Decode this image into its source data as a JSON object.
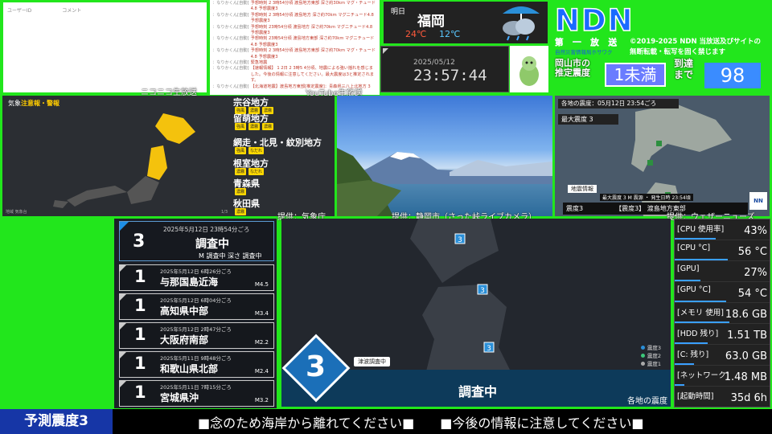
{
  "comments": {
    "col_user": "ユーザーID",
    "col_comment": "コメント",
    "label": "ニコニコ生放送"
  },
  "youtube": {
    "label": "YouTube生放送",
    "rows": [
      {
        "name": "：なりかくん[自動]",
        "text": "予想時刻 2 3時54分頃 渡島地方東部 深さ約30km マグ・チュード4.8 予想震度3"
      },
      {
        "name": "：なりかくん[自動]",
        "text": "予想時刻 2 3時54分頃 渡島地方 深さ約70km マグニチュード4.8 予想震度3"
      },
      {
        "name": "：なりかくん[自動]",
        "text": "予想時刻 23時54分頃 渡島地方 深さ約70km マグニチュード4.8 予想震度3"
      },
      {
        "name": "：なりかくん[自動]",
        "text": "予想時刻 23時54分頃 渡島地方東部 深さ約70km マグニチュード4.8 予想震度3"
      },
      {
        "name": "：なりかくん[自動]",
        "text": "予想時刻 2 3時54分頃 渡島地方東部 深さ約70km マグ・チュード4.8 予想震度3"
      },
      {
        "name": "：なりかくん[自動]",
        "text": "緊急地震"
      },
      {
        "name": "：なりかくん[自動]",
        "text": "【速報情報】 1 2日 2 3時5 4分頃、地震による強い揺れを感じました。今後の情報に注意してください。最大震度は3と推定されます。"
      },
      {
        "name": "：なりかくん[自動]",
        "text": "【北海道地震】渡島地方東部[推定震度]：青森県三八上北地方 3"
      }
    ]
  },
  "weather": {
    "date": "明日",
    "city": "福岡",
    "high": "24℃",
    "low": "12℃",
    "icon": "rain-cloud-icon"
  },
  "clock": {
    "date": "2025/05/12",
    "time": "23:57:44"
  },
  "brand": {
    "name": "NDN",
    "subtitle": "第 一 放 送",
    "sub2": "自然災害情報局ホサワク",
    "copyright_1": "©2019-2025 NDN 当放送及びサイトの",
    "copyright_2": "無断転載・転写を固く禁じます"
  },
  "estimate": {
    "place_1": "岡山市の",
    "place_2": "推定震度",
    "value": "1未満",
    "arrival_1": "到達",
    "arrival_2": "まで",
    "seconds": "98"
  },
  "warnings": {
    "title_1": "気象",
    "title_2": "注意報・警報",
    "credit": "提供：気象庁",
    "page": "1/3",
    "footer": "地域 気象台",
    "areas": [
      {
        "name": "宗谷地方",
        "tags": [
          "強風",
          "濃霧",
          "濃霧"
        ]
      },
      {
        "name": "留萌地方",
        "tags": [
          "強風",
          "濃霧",
          "濃霧"
        ]
      },
      {
        "name": "網走・北見・紋別地方",
        "tags": [
          "強風",
          "なだれ"
        ]
      },
      {
        "name": "根室地方",
        "tags": [
          "濃霧",
          "なだれ"
        ]
      },
      {
        "name": "青森県",
        "tags": [
          "濃霧"
        ]
      },
      {
        "name": "秋田県",
        "tags": [
          "濃霧"
        ]
      }
    ]
  },
  "camera": {
    "credit": "提供：静岡市（さった峠ライブカメラ）"
  },
  "shindo_map": {
    "title": "各地の震度：05月12日 23:54ごろ",
    "max": "最大震度 3",
    "info_title": "地震情報",
    "info_detail": "最大震度 3 M 震源 ・ 発生日時 23:54頃",
    "badge": "震度3",
    "headline": "【震度3】 渡島地方東部",
    "credit": "提供：ウェザーニューズ",
    "logo": "NN"
  },
  "quake_top": {
    "date": "2025年5月12日 23時54分ごろ",
    "intensity": "3",
    "place": "調査中",
    "detail": "M 調査中 深さ 調査中"
  },
  "quakes": [
    {
      "date": "2025年5月12日 6時26分ごろ",
      "intensity": "1",
      "place": "与那国島近海",
      "mag": "M4.5"
    },
    {
      "date": "2025年5月12日 6時04分ごろ",
      "intensity": "1",
      "place": "高知県中部",
      "mag": "M3.4"
    },
    {
      "date": "2025年5月12日 2時47分ごろ",
      "intensity": "1",
      "place": "大阪府南部",
      "mag": "M2.2"
    },
    {
      "date": "2025年5月11日 9時48分ごろ",
      "intensity": "1",
      "place": "和歌山県北部",
      "mag": "M2.4"
    },
    {
      "date": "2025年5月11日 7時15分ごろ",
      "intensity": "1",
      "place": "宮城県沖",
      "mag": "M3.2"
    }
  ],
  "bigmap": {
    "intensity": "3",
    "tsunami": "津波調査中",
    "status": "調査中",
    "caption": "各地の震度",
    "markers": [
      "3",
      "3",
      "3"
    ],
    "legend": [
      "震度3",
      "震度2",
      "震度1"
    ]
  },
  "system": [
    {
      "k": "[CPU 使用率]",
      "v": "43%",
      "fill": 0.43
    },
    {
      "k": "[CPU °C]",
      "v": "56 °C",
      "fill": 0.56
    },
    {
      "k": "[GPU]",
      "v": "27%",
      "fill": 0.27
    },
    {
      "k": "[GPU °C]",
      "v": "54 °C",
      "fill": 0.54
    },
    {
      "k": "[メモリ 使用]",
      "v": "18.6 GB",
      "fill": 0.58
    },
    {
      "k": "[HDD 残り]",
      "v": "1.51 TB",
      "fill": 0.35
    },
    {
      "k": "[C: 残り]",
      "v": "63.0 GB",
      "fill": 0.2
    },
    {
      "k": "[ネットワーク]",
      "v": "1.48 MB",
      "fill": 0.1
    },
    {
      "k": "[起動時間]",
      "v": "35d 6h",
      "fill": 0
    }
  ],
  "ticker": {
    "label": "予測震度3",
    "text": "■念のため海岸から離れてください■　　■今後の情報に注意してください■"
  }
}
